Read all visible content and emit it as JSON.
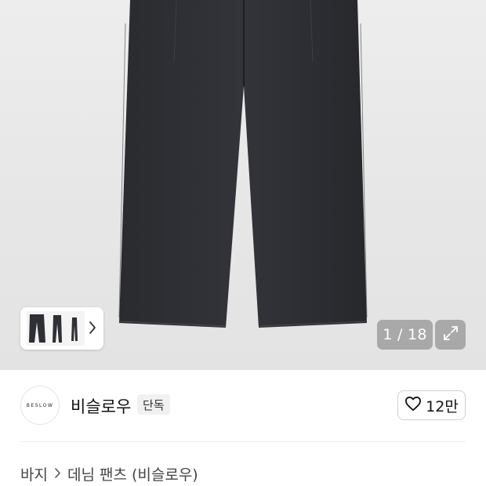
{
  "gallery": {
    "counter": "1 / 18",
    "icons": {
      "expand": "expand-arrows-icon",
      "thumbnail_next": "chevron-right-icon"
    }
  },
  "brand": {
    "logo_text": "BESLOW",
    "name": "비슬로우",
    "badge": "단독",
    "like_count": "12만",
    "like_icon": "heart-outline-icon"
  },
  "breadcrumb": {
    "category": "바지",
    "product": "데님 팬츠 (비슬로우)",
    "separator_icon": "chevron-right-icon"
  }
}
